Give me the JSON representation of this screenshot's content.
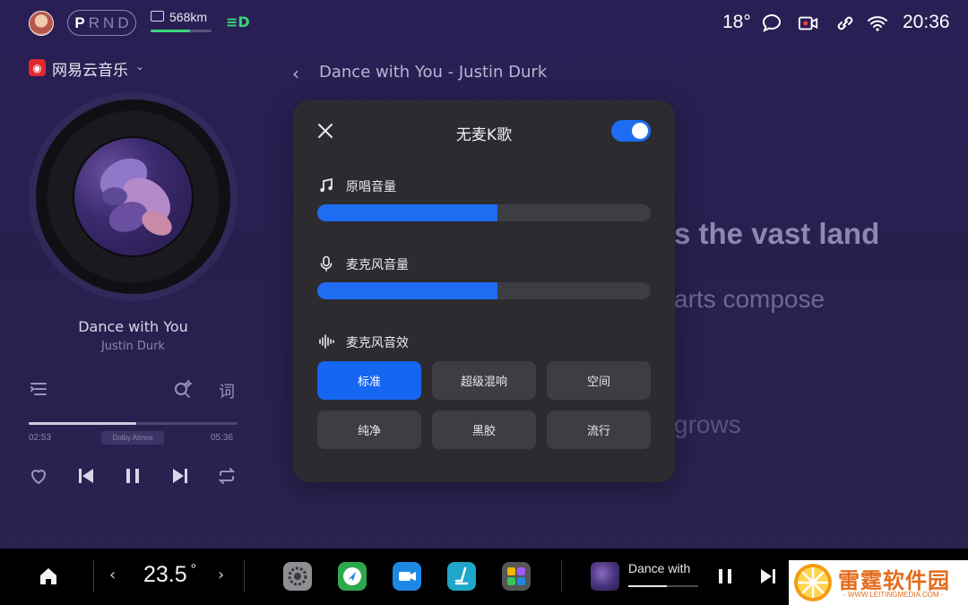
{
  "status_bar": {
    "gear": [
      "P",
      "R",
      "N",
      "D"
    ],
    "active_gear": "P",
    "range": "568km",
    "range_level": 0.65,
    "temperature": "18°",
    "clock": "20:36",
    "icons": [
      "avatar",
      "battery-range-icon",
      "headlight-icon",
      "message-icon",
      "record-camera-icon",
      "link-icon",
      "wifi-icon"
    ]
  },
  "music": {
    "app_name": "网易云音乐",
    "song_title": "Dance with You",
    "artist": "Justin Durk",
    "current_time": "02:53",
    "total_time": "05:36",
    "progress": 0.515,
    "dolby": "Dolby Atmos",
    "lyrics_label": "词"
  },
  "header": {
    "title": "Dance with You - Justin Durk"
  },
  "lyrics": [
    "s the vast land",
    "arts compose",
    "grows"
  ],
  "karaoke_panel": {
    "title": "无麦K歌",
    "enabled": true,
    "original_volume_label": "原唱音量",
    "original_volume": 0.54,
    "mic_volume_label": "麦克风音量",
    "mic_volume": 0.54,
    "effects_label": "麦克风音效",
    "effects": [
      "标准",
      "超级混响",
      "空间",
      "纯净",
      "黑胶",
      "流行"
    ],
    "selected_effect": "标准"
  },
  "dock": {
    "temperature": "23.5",
    "degree": "°",
    "now_playing": "Dance with",
    "now_playing_progress": 0.55,
    "apps": [
      "settings-app-icon",
      "navigation-app-icon",
      "video-call-app-icon",
      "seat-app-icon",
      "app-grid-icon"
    ]
  },
  "watermark": {
    "name": "雷霆软件园",
    "url": "WWW.LEITINGMEDIA.COM"
  },
  "colors": {
    "accent": "#1f6cf2",
    "green": "#37d67a",
    "background": "#2a1f55",
    "panel": "#2b2b30"
  }
}
